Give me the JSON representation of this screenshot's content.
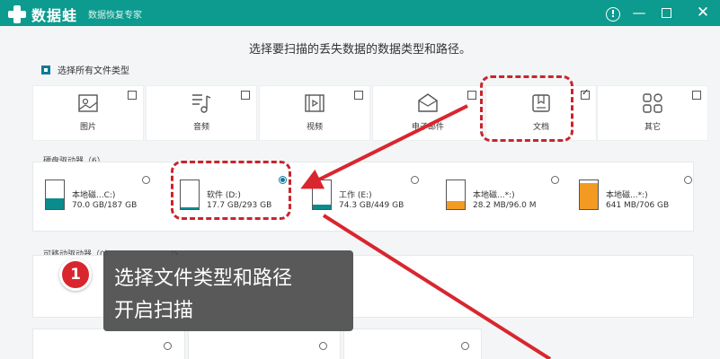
{
  "app": {
    "name": "数据蛙",
    "slogan": "数据恢复专家"
  },
  "titlebar_icons": [
    "help-icon",
    "minimize-icon",
    "maximize-icon",
    "close-icon"
  ],
  "heading": "选择要扫描的丢失数据的数据类型和路径。",
  "select_all": {
    "label": "选择所有文件类型",
    "checked": true
  },
  "file_types": [
    {
      "label": "图片",
      "icon": "image-icon",
      "checked": false
    },
    {
      "label": "音频",
      "icon": "audio-icon",
      "checked": false
    },
    {
      "label": "视频",
      "icon": "video-icon",
      "checked": false
    },
    {
      "label": "电子邮件",
      "icon": "email-icon",
      "checked": false
    },
    {
      "label": "文档",
      "icon": "document-icon",
      "checked": true
    },
    {
      "label": "其它",
      "icon": "other-icon",
      "checked": false
    }
  ],
  "hard_drives": {
    "label": "硬盘驱动器（6）",
    "drives": [
      {
        "name": "本地磁...C:)",
        "capacity": "70.0 GB/187 GB",
        "usage": 0.37,
        "selected": false,
        "color": "#0c8b8e"
      },
      {
        "name": "软件 (D:)",
        "capacity": "17.7 GB/293 GB",
        "usage": 0.06,
        "selected": true,
        "color": "#0c8b8e"
      },
      {
        "name": "工作 (E:)",
        "capacity": "74.3 GB/449 GB",
        "usage": 0.17,
        "selected": false,
        "color": "#0c8b8e"
      },
      {
        "name": "本地磁...*:)",
        "capacity": "28.2 MB/96.0 M",
        "usage": 0.29,
        "selected": false,
        "color": "#f39a23"
      },
      {
        "name": "本地磁...*:)",
        "capacity": "641 MB/706 GB",
        "usage": 0.91,
        "selected": false,
        "color": "#f39a23"
      }
    ]
  },
  "removable": {
    "label": "可移动驱动器（0）",
    "refresh_icon": "refresh-icon"
  },
  "annotation": {
    "step": "1",
    "line1": "选择文件类型和路径",
    "line2": "开启扫描",
    "color": "#c9252c"
  }
}
